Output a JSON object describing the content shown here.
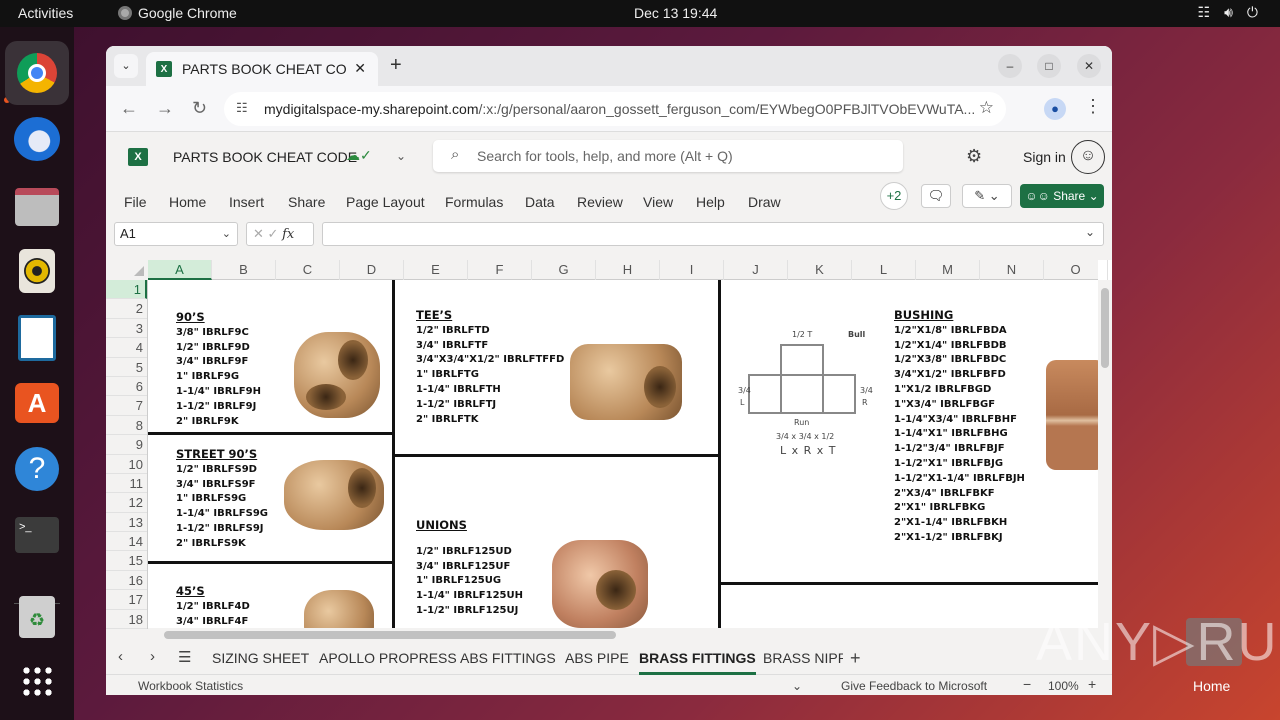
{
  "topbar": {
    "activities": "Activities",
    "app_name": "Google Chrome",
    "clock": "Dec 13  19:44"
  },
  "dock": {
    "items": [
      "Google Chrome",
      "Thunderbird Mail",
      "Files",
      "Rhythmbox",
      "LibreOffice Writer",
      "Ubuntu Software",
      "Help",
      "Terminal",
      "Trash",
      "Show Applications"
    ]
  },
  "browser": {
    "tab_title": "PARTS BOOK CHEAT CO",
    "url_domain": "mydigitalspace-my.sharepoint.com",
    "url_path": "/:x:/g/personal/aaron_gossett_ferguson_com/EYWbegO0PFBJlTVObEVWuTA..."
  },
  "excel": {
    "doc_title": "PARTS BOOK CHEAT CODE",
    "search_placeholder": "Search for tools, help, and more (Alt + Q)",
    "sign_in": "Sign in",
    "ribbon_tabs": [
      "File",
      "Home",
      "Insert",
      "Share",
      "Page Layout",
      "Formulas",
      "Data",
      "Review",
      "View",
      "Help",
      "Draw"
    ],
    "collaborators": "+2",
    "share_label": "Share",
    "name_box": "A1",
    "fx_label": "fx",
    "columns": [
      "A",
      "B",
      "C",
      "D",
      "E",
      "F",
      "G",
      "H",
      "I",
      "J",
      "K",
      "L",
      "M",
      "N",
      "O"
    ],
    "active_column": "A",
    "rows": [
      "1",
      "2",
      "3",
      "4",
      "5",
      "6",
      "7",
      "8",
      "9",
      "10",
      "11",
      "12",
      "13",
      "14",
      "15",
      "16",
      "17",
      "18"
    ],
    "sheet_tabs": [
      "SIZING SHEET",
      "APOLLO PROPRESS",
      "ABS FITTINGS",
      "ABS PIPE",
      "BRASS FITTINGS",
      "BRASS NIPPL"
    ],
    "active_sheet": "BRASS FITTINGS",
    "status_left": "Workbook Statistics",
    "feedback": "Give Feedback to Microsoft",
    "zoom": "100%"
  },
  "sheet_content": {
    "nineties": {
      "heading": "90’S",
      "items": [
        "3/8\" IBRLF9C",
        "1/2\" IBRLF9D",
        "3/4\" IBRLF9F",
        "1\" IBRLF9G",
        "1-1/4\" IBRLF9H",
        "1-1/2\" IBRLF9J",
        "2\" IBRLF9K"
      ]
    },
    "street_nineties": {
      "heading": "STREET 90’S",
      "items": [
        "1/2\" IBRLFS9D",
        "3/4\" IBRLFS9F",
        "1\" IBRLFS9G",
        "1-1/4\" IBRLFS9G",
        "1-1/2\" IBRLFS9J",
        "2\" IBRLFS9K"
      ]
    },
    "fortyfives": {
      "heading": "45’S",
      "items": [
        "1/2\" IBRLF4D",
        "3/4\" IBRLF4F"
      ]
    },
    "tees": {
      "heading": "TEE’S",
      "items": [
        "1/2\" IBRLFTD",
        "3/4\" IBRLFTF",
        "3/4\"X3/4\"X1/2\" IBRLFTFFD",
        "1\" IBRLFTG",
        "1-1/4\" IBRLFTH",
        "1-1/2\" IBRLFTJ",
        "2\" IBRLFTK"
      ]
    },
    "unions": {
      "heading": "UNIONS",
      "items": [
        "1/2\" IBRLF125UD",
        "3/4\" IBRLF125UF",
        "1\" IBRLF125UG",
        "1-1/4\" IBRLF125UH",
        "1-1/2\" IBRLF125UJ"
      ]
    },
    "tee_diagram": {
      "top": "1/2  T",
      "bull": "Bull",
      "left": "3/4",
      "left_letter": "L",
      "right": "3/4",
      "right_letter": "R",
      "run": "Run",
      "dims": "3/4 x 3/4 x 1/2",
      "formula": "L x R x T"
    },
    "bushing": {
      "heading": "BUSHING",
      "items": [
        "1/2\"X1/8\" IBRLFBDA",
        "1/2\"X1/4\" IBRLFBDB",
        "1/2\"X3/8\" IBRLFBDC",
        "3/4\"X1/2\" IBRLFBFD",
        "1\"X1/2 IBRLFBGD",
        "1\"X3/4\" IBRLFBGF",
        "1-1/4\"X3/4\" IBRLFBHF",
        "1-1/4\"X1\" IBRLFBHG",
        "1-1/2\"3/4\" IBRLFBJF",
        "1-1/2\"X1\" IBRLFBJG",
        "1-1/2\"X1-1/4\" IBRLFBJH",
        "2\"X3/4\" IBRLFBKF",
        "2\"X1\" IBRLFBKG",
        "2\"X1-1/4\" IBRLFBKH",
        "2\"X1-1/2\" IBRLFBKJ"
      ]
    }
  },
  "desktop": {
    "watermark": "ANY▷RUN",
    "home_label": "Home"
  },
  "colors": {
    "excel_green": "#1d7044",
    "ubuntu_orange": "#e95420"
  }
}
